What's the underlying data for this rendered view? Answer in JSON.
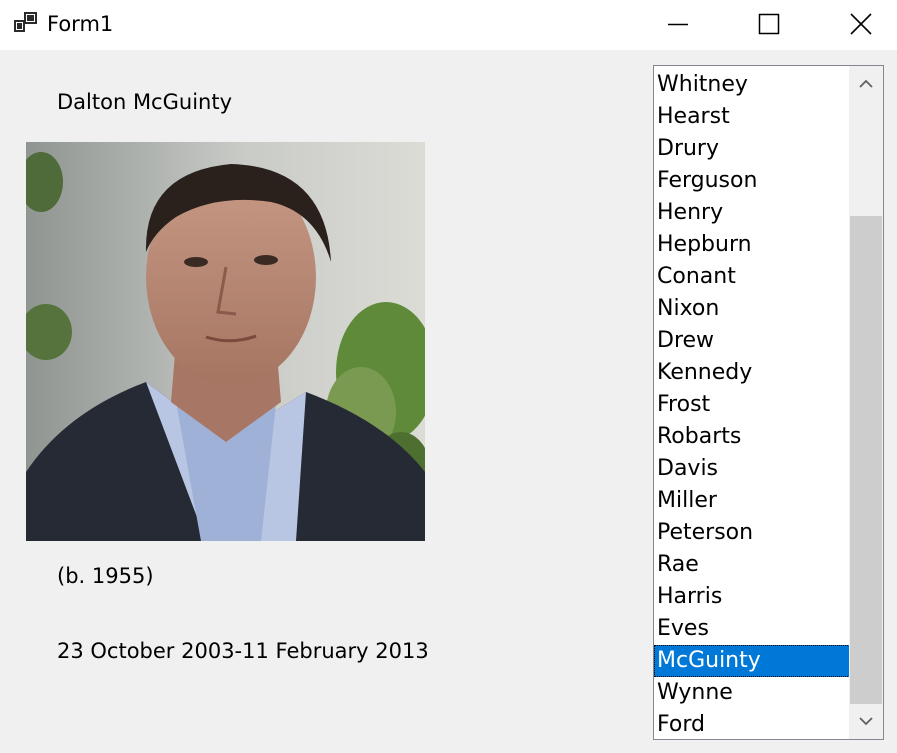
{
  "window": {
    "title": "Form1",
    "controls": {
      "minimize_icon": "minimize-icon",
      "maximize_icon": "maximize-icon",
      "close_icon": "close-icon"
    }
  },
  "details": {
    "name": "Dalton McGuinty",
    "born": "(b. 1955)",
    "term": "23 October 2003-11 February 2013"
  },
  "list": {
    "items": [
      "Whitney",
      "Hearst",
      "Drury",
      "Ferguson",
      "Henry",
      "Hepburn",
      "Conant",
      "Nixon",
      "Drew",
      "Kennedy",
      "Frost",
      "Robarts",
      "Davis",
      "Miller",
      "Peterson",
      "Rae",
      "Harris",
      "Eves",
      "McGuinty",
      "Wynne",
      "Ford"
    ],
    "selected": "McGuinty",
    "selection_color": "#0078d7"
  }
}
